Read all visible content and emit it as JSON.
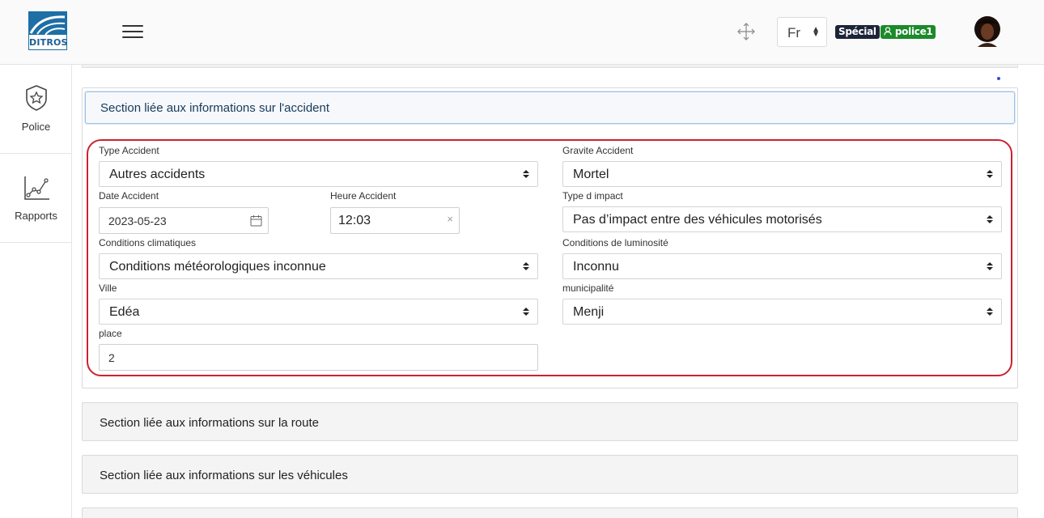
{
  "header": {
    "logo_text": "DITROS",
    "language": "Fr",
    "role_badge": "Spécial",
    "user_badge": "police1"
  },
  "sidebar": {
    "items": [
      {
        "label": "Police",
        "icon": "shield-star-icon"
      },
      {
        "label": "Rapports",
        "icon": "line-chart-icon"
      }
    ]
  },
  "sections": {
    "accident": {
      "title": "Section liée aux informations sur l'accident"
    },
    "route": {
      "title": "Section liée aux informations sur la route"
    },
    "vehicules": {
      "title": "Section liée aux informations sur les véhicules"
    }
  },
  "form": {
    "type_accident": {
      "label": "Type Accident",
      "value": "Autres accidents"
    },
    "gravite_accident": {
      "label": "Gravite Accident",
      "value": "Mortel"
    },
    "date_accident": {
      "label": "Date Accident",
      "value": "2023-05-23"
    },
    "heure_accident": {
      "label": "Heure Accident",
      "value": "12:03",
      "clear": "×"
    },
    "type_impact": {
      "label": "Type d impact",
      "value": "Pas d’impact entre des véhicules motorisés"
    },
    "conditions_climatiques": {
      "label": "Conditions climatiques",
      "value": "Conditions météorologiques inconnue"
    },
    "conditions_luminosite": {
      "label": "Conditions de luminosité",
      "value": "Inconnu"
    },
    "ville": {
      "label": "Ville",
      "value": "Edéa"
    },
    "municipalite": {
      "label": "municipalité",
      "value": "Menji"
    },
    "place": {
      "label": "place",
      "value": "2"
    }
  },
  "colors": {
    "highlight_outline": "#cc2131",
    "special_badge": "#1c2538",
    "user_badge": "#1b8a2a",
    "logo_blue": "#1d6fa5"
  }
}
